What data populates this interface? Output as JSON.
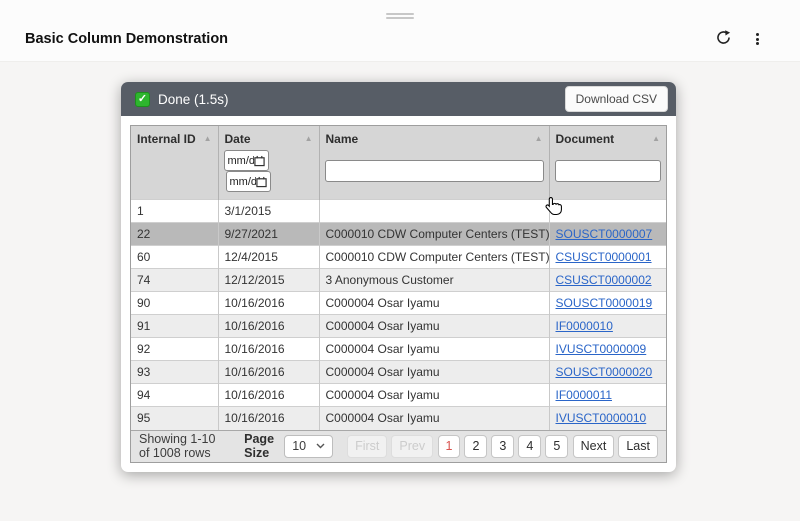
{
  "page": {
    "title": "Basic Column Demonstration"
  },
  "icons": {
    "check": "✓",
    "sort_asc": "▲"
  },
  "status_bar": {
    "status_text": "Done (1.5s)",
    "download_csv_label": "Download CSV"
  },
  "table": {
    "columns": [
      "Internal ID",
      "Date",
      "Name",
      "Document"
    ],
    "filters": {
      "date_placeholder": "mm/dd/yyyy"
    },
    "rows": [
      {
        "id": "1",
        "date": "3/1/2015",
        "name": "",
        "doc": ""
      },
      {
        "id": "22",
        "date": "9/27/2021",
        "name": "C000010 CDW Computer Centers (TEST)",
        "doc": "SOUSCT0000007",
        "state": "hovered"
      },
      {
        "id": "60",
        "date": "12/4/2015",
        "name": "C000010 CDW Computer Centers (TEST)",
        "doc": "CSUSCT0000001"
      },
      {
        "id": "74",
        "date": "12/12/2015",
        "name": "3 Anonymous Customer",
        "doc": "CSUSCT0000002"
      },
      {
        "id": "90",
        "date": "10/16/2016",
        "name": "C000004 Osar Iyamu",
        "doc": "SOUSCT0000019"
      },
      {
        "id": "91",
        "date": "10/16/2016",
        "name": "C000004 Osar Iyamu",
        "doc": "IF0000010"
      },
      {
        "id": "92",
        "date": "10/16/2016",
        "name": "C000004 Osar Iyamu",
        "doc": "IVUSCT0000009"
      },
      {
        "id": "93",
        "date": "10/16/2016",
        "name": "C000004 Osar Iyamu",
        "doc": "SOUSCT0000020"
      },
      {
        "id": "94",
        "date": "10/16/2016",
        "name": "C000004 Osar Iyamu",
        "doc": "IF0000011"
      },
      {
        "id": "95",
        "date": "10/16/2016",
        "name": "C000004 Osar Iyamu",
        "doc": "IVUSCT0000010"
      }
    ]
  },
  "pagination": {
    "summary": "Showing 1-10 of 1008 rows",
    "page_size_label": "Page Size",
    "page_size_value": "10",
    "first_label": "First",
    "prev_label": "Prev",
    "pages": [
      "1",
      "2",
      "3",
      "4",
      "5"
    ],
    "active_page": "1",
    "next_label": "Next",
    "last_label": "Last"
  },
  "colors": {
    "status_bar_bg": "#575d66",
    "check_green": "#2eb52e",
    "link_blue": "#2a65c8",
    "table_header_bg": "#d6d6d6",
    "hover_row_bg": "#b9b9b9",
    "stripe_row_bg": "#ededed",
    "active_page_text": "#d9534f"
  }
}
